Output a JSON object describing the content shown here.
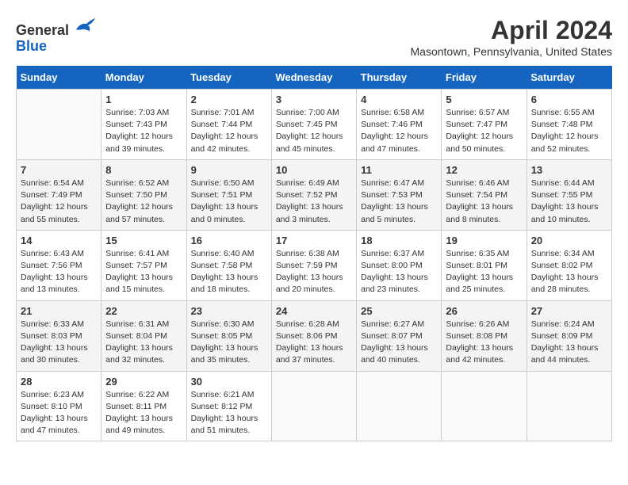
{
  "header": {
    "logo_general": "General",
    "logo_blue": "Blue",
    "month": "April 2024",
    "location": "Masontown, Pennsylvania, United States"
  },
  "columns": [
    "Sunday",
    "Monday",
    "Tuesday",
    "Wednesday",
    "Thursday",
    "Friday",
    "Saturday"
  ],
  "weeks": [
    [
      {
        "num": "",
        "sunrise": "",
        "sunset": "",
        "daylight": ""
      },
      {
        "num": "1",
        "sunrise": "Sunrise: 7:03 AM",
        "sunset": "Sunset: 7:43 PM",
        "daylight": "Daylight: 12 hours and 39 minutes."
      },
      {
        "num": "2",
        "sunrise": "Sunrise: 7:01 AM",
        "sunset": "Sunset: 7:44 PM",
        "daylight": "Daylight: 12 hours and 42 minutes."
      },
      {
        "num": "3",
        "sunrise": "Sunrise: 7:00 AM",
        "sunset": "Sunset: 7:45 PM",
        "daylight": "Daylight: 12 hours and 45 minutes."
      },
      {
        "num": "4",
        "sunrise": "Sunrise: 6:58 AM",
        "sunset": "Sunset: 7:46 PM",
        "daylight": "Daylight: 12 hours and 47 minutes."
      },
      {
        "num": "5",
        "sunrise": "Sunrise: 6:57 AM",
        "sunset": "Sunset: 7:47 PM",
        "daylight": "Daylight: 12 hours and 50 minutes."
      },
      {
        "num": "6",
        "sunrise": "Sunrise: 6:55 AM",
        "sunset": "Sunset: 7:48 PM",
        "daylight": "Daylight: 12 hours and 52 minutes."
      }
    ],
    [
      {
        "num": "7",
        "sunrise": "Sunrise: 6:54 AM",
        "sunset": "Sunset: 7:49 PM",
        "daylight": "Daylight: 12 hours and 55 minutes."
      },
      {
        "num": "8",
        "sunrise": "Sunrise: 6:52 AM",
        "sunset": "Sunset: 7:50 PM",
        "daylight": "Daylight: 12 hours and 57 minutes."
      },
      {
        "num": "9",
        "sunrise": "Sunrise: 6:50 AM",
        "sunset": "Sunset: 7:51 PM",
        "daylight": "Daylight: 13 hours and 0 minutes."
      },
      {
        "num": "10",
        "sunrise": "Sunrise: 6:49 AM",
        "sunset": "Sunset: 7:52 PM",
        "daylight": "Daylight: 13 hours and 3 minutes."
      },
      {
        "num": "11",
        "sunrise": "Sunrise: 6:47 AM",
        "sunset": "Sunset: 7:53 PM",
        "daylight": "Daylight: 13 hours and 5 minutes."
      },
      {
        "num": "12",
        "sunrise": "Sunrise: 6:46 AM",
        "sunset": "Sunset: 7:54 PM",
        "daylight": "Daylight: 13 hours and 8 minutes."
      },
      {
        "num": "13",
        "sunrise": "Sunrise: 6:44 AM",
        "sunset": "Sunset: 7:55 PM",
        "daylight": "Daylight: 13 hours and 10 minutes."
      }
    ],
    [
      {
        "num": "14",
        "sunrise": "Sunrise: 6:43 AM",
        "sunset": "Sunset: 7:56 PM",
        "daylight": "Daylight: 13 hours and 13 minutes."
      },
      {
        "num": "15",
        "sunrise": "Sunrise: 6:41 AM",
        "sunset": "Sunset: 7:57 PM",
        "daylight": "Daylight: 13 hours and 15 minutes."
      },
      {
        "num": "16",
        "sunrise": "Sunrise: 6:40 AM",
        "sunset": "Sunset: 7:58 PM",
        "daylight": "Daylight: 13 hours and 18 minutes."
      },
      {
        "num": "17",
        "sunrise": "Sunrise: 6:38 AM",
        "sunset": "Sunset: 7:59 PM",
        "daylight": "Daylight: 13 hours and 20 minutes."
      },
      {
        "num": "18",
        "sunrise": "Sunrise: 6:37 AM",
        "sunset": "Sunset: 8:00 PM",
        "daylight": "Daylight: 13 hours and 23 minutes."
      },
      {
        "num": "19",
        "sunrise": "Sunrise: 6:35 AM",
        "sunset": "Sunset: 8:01 PM",
        "daylight": "Daylight: 13 hours and 25 minutes."
      },
      {
        "num": "20",
        "sunrise": "Sunrise: 6:34 AM",
        "sunset": "Sunset: 8:02 PM",
        "daylight": "Daylight: 13 hours and 28 minutes."
      }
    ],
    [
      {
        "num": "21",
        "sunrise": "Sunrise: 6:33 AM",
        "sunset": "Sunset: 8:03 PM",
        "daylight": "Daylight: 13 hours and 30 minutes."
      },
      {
        "num": "22",
        "sunrise": "Sunrise: 6:31 AM",
        "sunset": "Sunset: 8:04 PM",
        "daylight": "Daylight: 13 hours and 32 minutes."
      },
      {
        "num": "23",
        "sunrise": "Sunrise: 6:30 AM",
        "sunset": "Sunset: 8:05 PM",
        "daylight": "Daylight: 13 hours and 35 minutes."
      },
      {
        "num": "24",
        "sunrise": "Sunrise: 6:28 AM",
        "sunset": "Sunset: 8:06 PM",
        "daylight": "Daylight: 13 hours and 37 minutes."
      },
      {
        "num": "25",
        "sunrise": "Sunrise: 6:27 AM",
        "sunset": "Sunset: 8:07 PM",
        "daylight": "Daylight: 13 hours and 40 minutes."
      },
      {
        "num": "26",
        "sunrise": "Sunrise: 6:26 AM",
        "sunset": "Sunset: 8:08 PM",
        "daylight": "Daylight: 13 hours and 42 minutes."
      },
      {
        "num": "27",
        "sunrise": "Sunrise: 6:24 AM",
        "sunset": "Sunset: 8:09 PM",
        "daylight": "Daylight: 13 hours and 44 minutes."
      }
    ],
    [
      {
        "num": "28",
        "sunrise": "Sunrise: 6:23 AM",
        "sunset": "Sunset: 8:10 PM",
        "daylight": "Daylight: 13 hours and 47 minutes."
      },
      {
        "num": "29",
        "sunrise": "Sunrise: 6:22 AM",
        "sunset": "Sunset: 8:11 PM",
        "daylight": "Daylight: 13 hours and 49 minutes."
      },
      {
        "num": "30",
        "sunrise": "Sunrise: 6:21 AM",
        "sunset": "Sunset: 8:12 PM",
        "daylight": "Daylight: 13 hours and 51 minutes."
      },
      {
        "num": "",
        "sunrise": "",
        "sunset": "",
        "daylight": ""
      },
      {
        "num": "",
        "sunrise": "",
        "sunset": "",
        "daylight": ""
      },
      {
        "num": "",
        "sunrise": "",
        "sunset": "",
        "daylight": ""
      },
      {
        "num": "",
        "sunrise": "",
        "sunset": "",
        "daylight": ""
      }
    ]
  ]
}
